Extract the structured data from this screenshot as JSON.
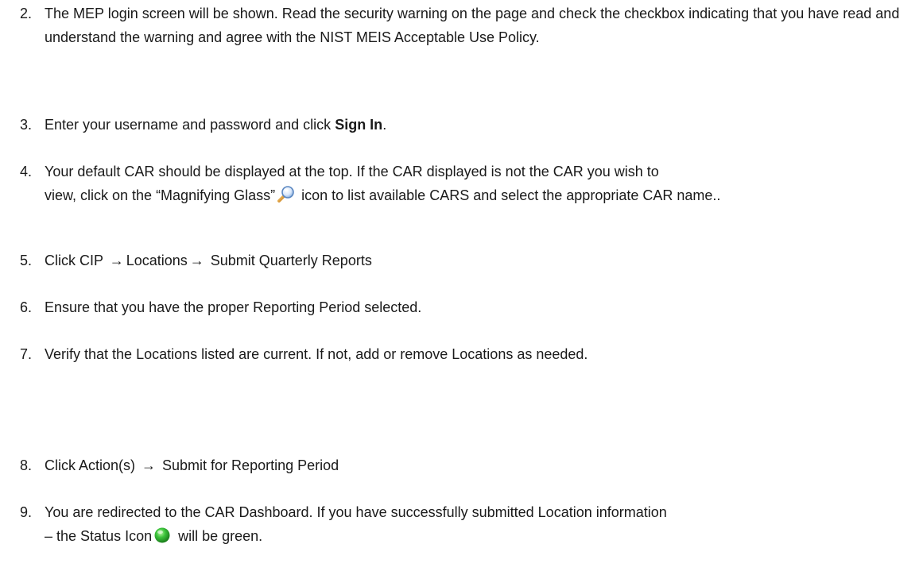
{
  "steps": [
    {
      "number": "2.",
      "text": "The MEP login screen will be shown.  Read the security warning on the page and check the checkbox indicating that you have read and understand the warning and agree with the NIST MEIS Acceptable Use Policy."
    },
    {
      "number": "3.",
      "text_before": "Enter your username and password and click ",
      "bold": "Sign In",
      "text_after": "."
    },
    {
      "number": "4.",
      "text_line1": "Your default CAR should be displayed at the top.  If the CAR displayed is not the CAR you wish to",
      "text_before_icon": "view, click on the “Magnifying Glass”",
      "text_after_icon": " icon to list available CARS and select the appropriate CAR name.."
    },
    {
      "number": "5.",
      "part1": "Click CIP ",
      "arrow1": "→",
      "part2": "Locations",
      "arrow2": "→",
      "part3": " Submit Quarterly Reports"
    },
    {
      "number": "6.",
      "text": "Ensure that you have the proper Reporting Period selected."
    },
    {
      "number": "7.",
      "text": "Verify that the Locations listed are current.  If not, add or remove Locations as needed."
    },
    {
      "number": "8.",
      "part1": "Click Action(s) ",
      "arrow1": "→",
      "part2": " Submit for Reporting Period"
    },
    {
      "number": "9.",
      "text_line1": "You are redirected to the CAR Dashboard. If you have successfully submitted Location information",
      "text_before_icon": "– the Status Icon",
      "text_after_icon": " will be green."
    }
  ],
  "icons": {
    "magnifier": "magnifying-glass-icon",
    "status": "green-status-icon"
  },
  "colors": {
    "text": "#1a1a1a",
    "status_green": "#3cc43c"
  }
}
